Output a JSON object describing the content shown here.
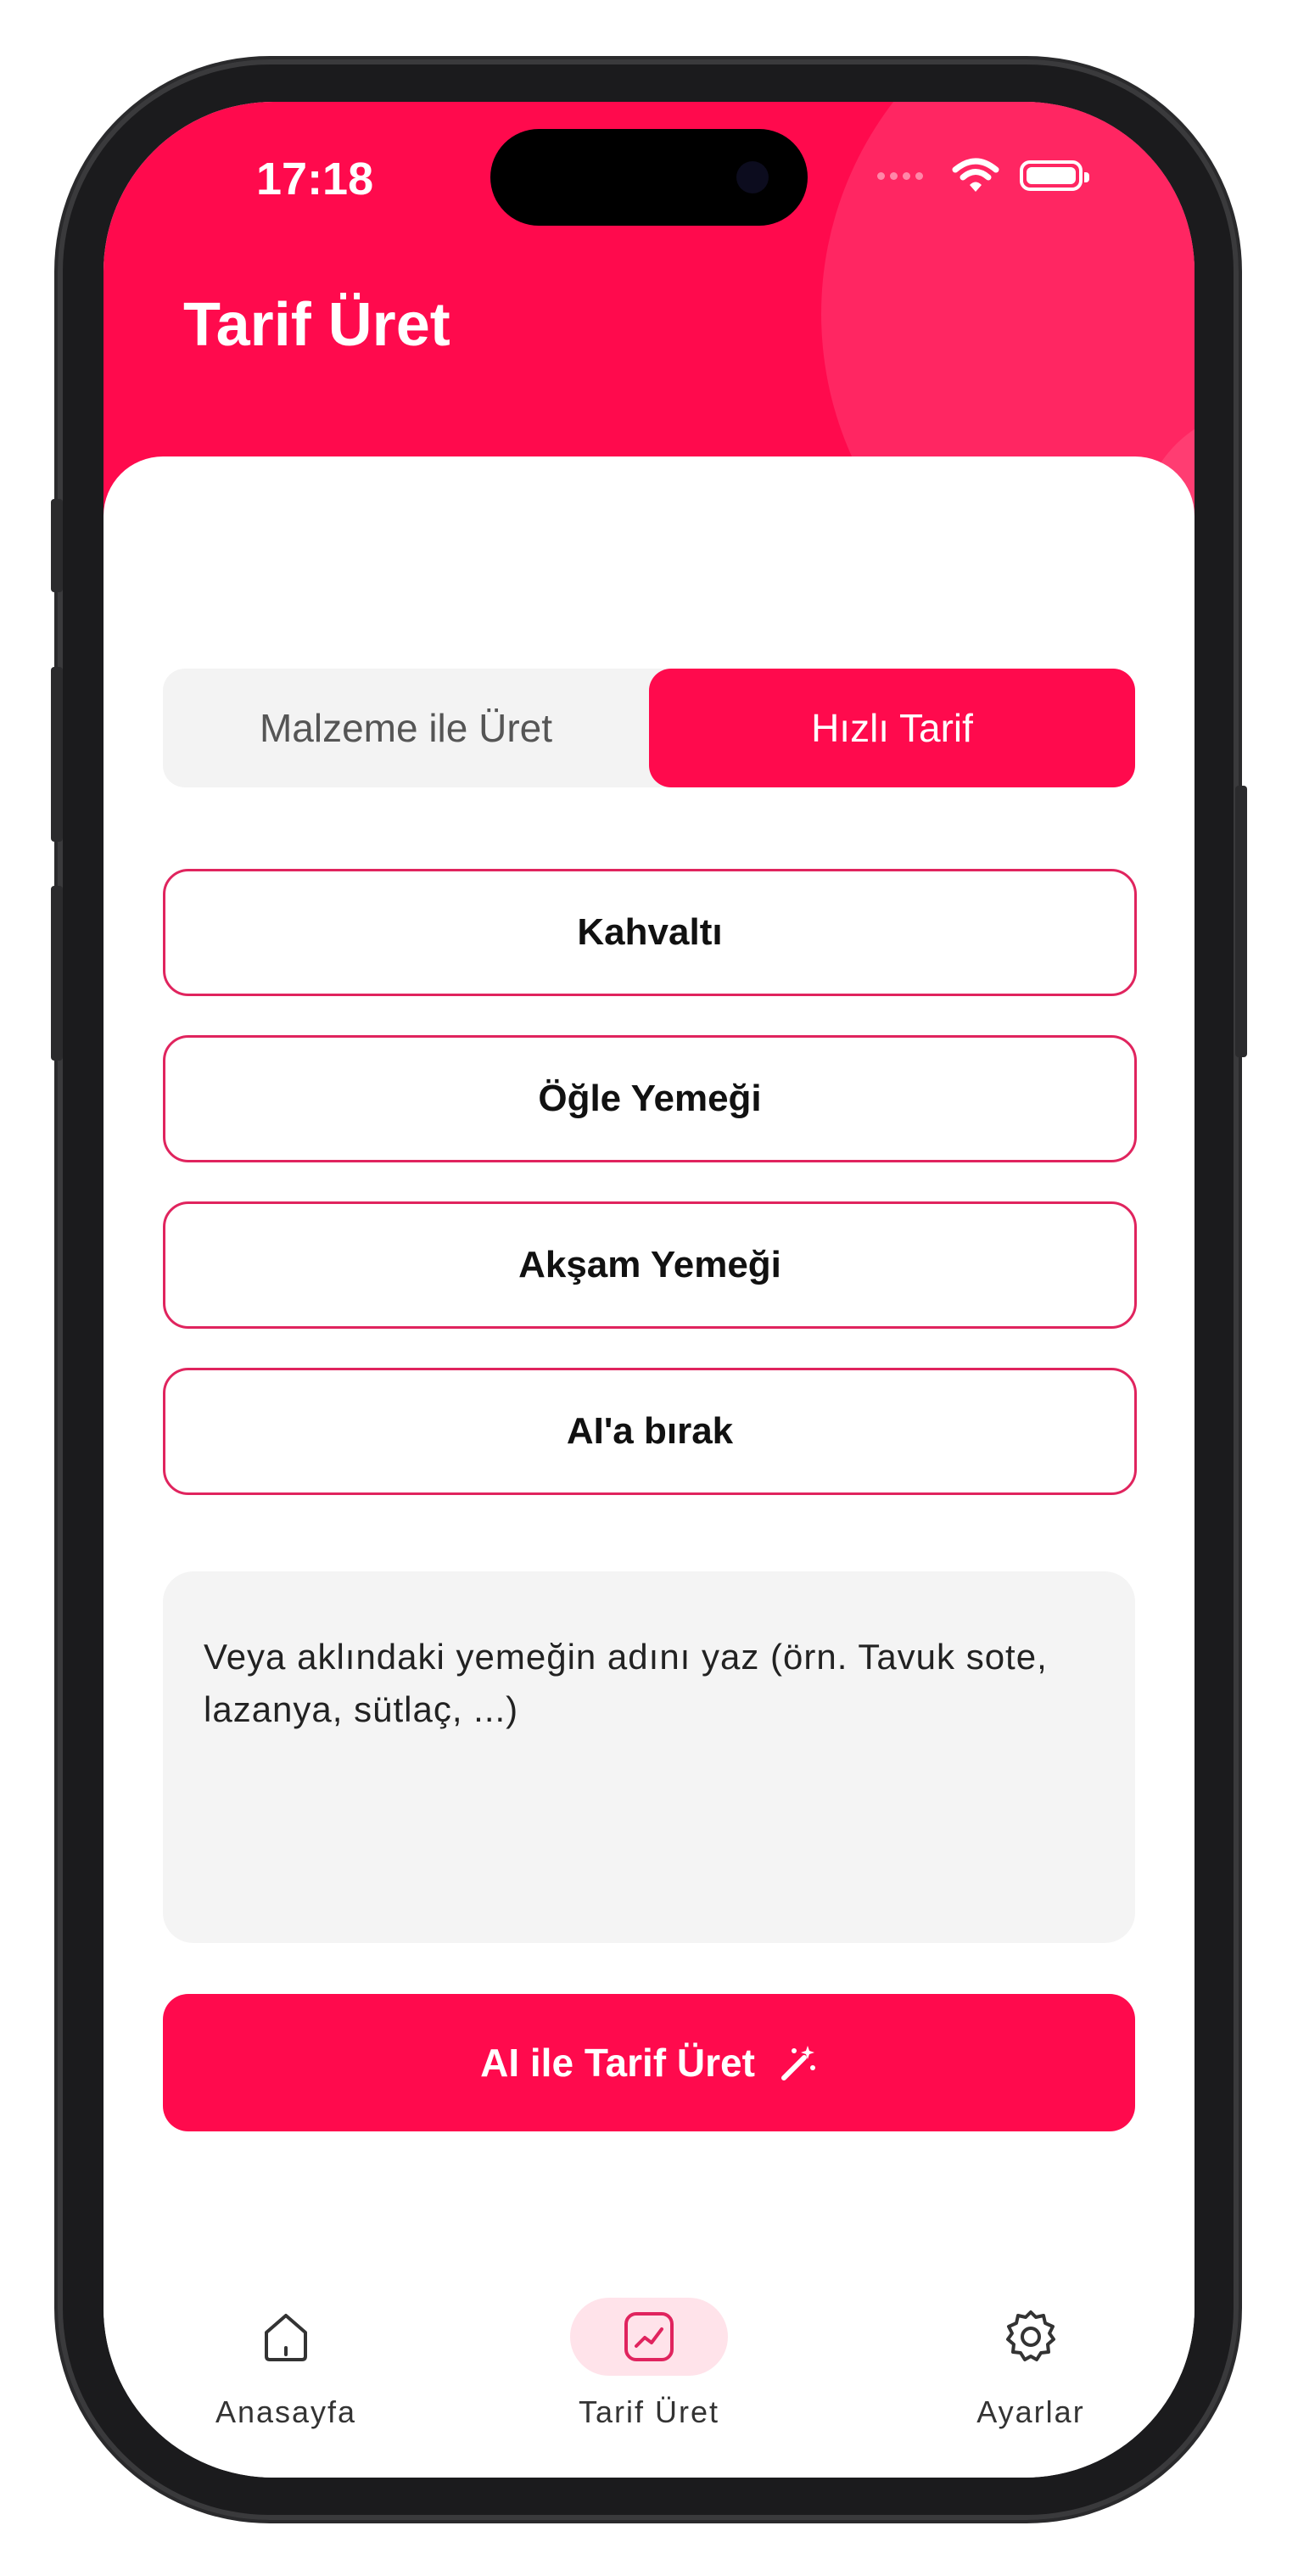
{
  "status": {
    "time": "17:18"
  },
  "header": {
    "title": "Tarif Üret"
  },
  "segment": {
    "left": "Malzeme ile Üret",
    "right": "Hızlı Tarif"
  },
  "options": [
    "Kahvaltı",
    "Öğle Yemeği",
    "Akşam Yemeği",
    "AI'a bırak"
  ],
  "input": {
    "placeholder": "Veya aklındaki yemeğin adını yaz (örn. Tavuk sote, lazanya, sütlaç, ...)"
  },
  "primary_button": {
    "label": "AI ile Tarif Üret"
  },
  "tabs": [
    {
      "label": "Anasayfa",
      "icon": "home-icon"
    },
    {
      "label": "Tarif Üret",
      "icon": "chart-icon"
    },
    {
      "label": "Ayarlar",
      "icon": "gear-icon"
    }
  ],
  "colors": {
    "accent": "#ff0a4d",
    "accent_light": "#ffe3ea",
    "border": "#e0245e"
  }
}
